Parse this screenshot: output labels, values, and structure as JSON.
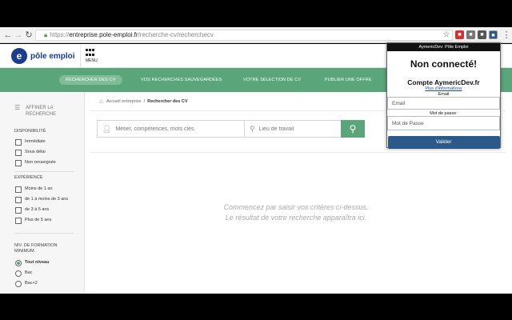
{
  "browser": {
    "url_scheme": "https://",
    "url_host": "entreprise.pole-emploi.fr",
    "url_path": "/recherche-cv/recherchecv"
  },
  "site": {
    "logo_text": "pôle emploi",
    "logo_mark": "e",
    "menu_label": "MENU",
    "nav": [
      "RECHERCHER DES CV",
      "VOS RECHERCHES SAUVEGARDÉES",
      "VOTRE SÉLECTION DE CV",
      "PUBLIER UNE OFFRE"
    ],
    "colors": {
      "brand_green": "#5aa57a",
      "brand_blue": "#1a3e8c"
    }
  },
  "sidebar": {
    "filter_heading": "AFFINER LA RECHERCHE",
    "disponibilite": {
      "title": "DISPONIBILITÉ",
      "items": [
        "Immédiate",
        "Sous délai",
        "Non renseignée"
      ]
    },
    "experience": {
      "title": "EXPÉRIENCE",
      "items": [
        "Moins de 1 an",
        "de 1 à moins de 3 ans",
        "de 3 à 5 ans",
        "Plus de 5 ans"
      ]
    },
    "formation": {
      "title": "NIV. DE FORMATION MINIMUM",
      "items": [
        "Tout niveau",
        "Bac",
        "Bac+2"
      ],
      "selected": "Tout niveau"
    }
  },
  "main": {
    "breadcrumb_home": "Accueil entreprise",
    "breadcrumb_sep": "/",
    "breadcrumb_current": "Rechercher des CV",
    "search_placeholder": "Métier, compétences, mots clés",
    "location_placeholder": "Lieu de travail",
    "empty_line1": "Commencez par saisir vos critères ci-dessus.",
    "empty_line2": "Le résultat de votre recherche apparaîtra ici."
  },
  "popup": {
    "title": "AymericDev: Pôle Emploi",
    "status": "Non connecté!",
    "account": "Compte AymericDev.fr",
    "more_link": "Plus d'informations",
    "email_label": "Email",
    "email_placeholder": "Email",
    "password_label": "Mot de passe:",
    "password_placeholder": "Mot de Passe",
    "submit_label": "Valider"
  }
}
